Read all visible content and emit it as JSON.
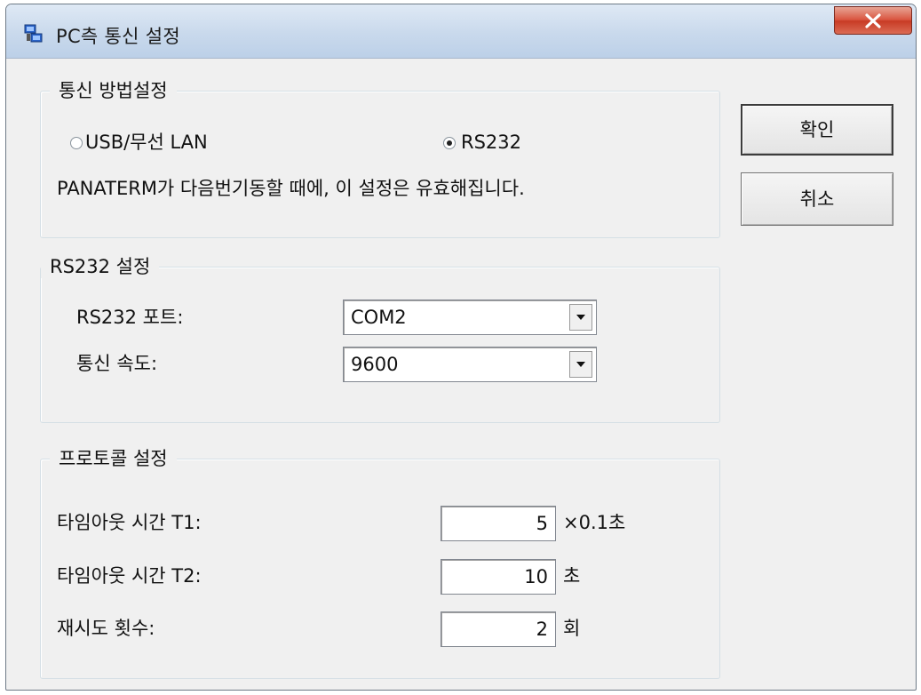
{
  "window": {
    "title": "PC측 통신 설정"
  },
  "buttons": {
    "ok": "확인",
    "cancel": "취소"
  },
  "comm_method": {
    "title": "통신 방법설정",
    "options": [
      {
        "label": "USB/무선 LAN",
        "checked": false
      },
      {
        "label": "RS232",
        "checked": true
      }
    ],
    "note": "PANATERM가 다음번기동할 때에, 이 설정은 유효해집니다."
  },
  "rs232": {
    "title": "RS232 설정",
    "port_label": "RS232 포트:",
    "port_value": "COM2",
    "speed_label": "통신 속도:",
    "speed_value": "9600"
  },
  "protocol": {
    "title": "프로토콜 설정",
    "rows": [
      {
        "label": "타임아웃 시간 T1:",
        "value": "5",
        "unit": "×0.1초"
      },
      {
        "label": "타임아웃 시간 T2:",
        "value": "10",
        "unit": "초"
      },
      {
        "label": "재시도 횟수:",
        "value": "2",
        "unit": "회"
      }
    ]
  },
  "icons": {
    "app": "window-app-icon",
    "close": "close-icon",
    "dropdown": "dropdown-arrow-icon"
  },
  "colors": {
    "close_button": "#d9543f",
    "titlebar": "#c9d9ec",
    "dialog_bg": "#f0f0f0"
  }
}
